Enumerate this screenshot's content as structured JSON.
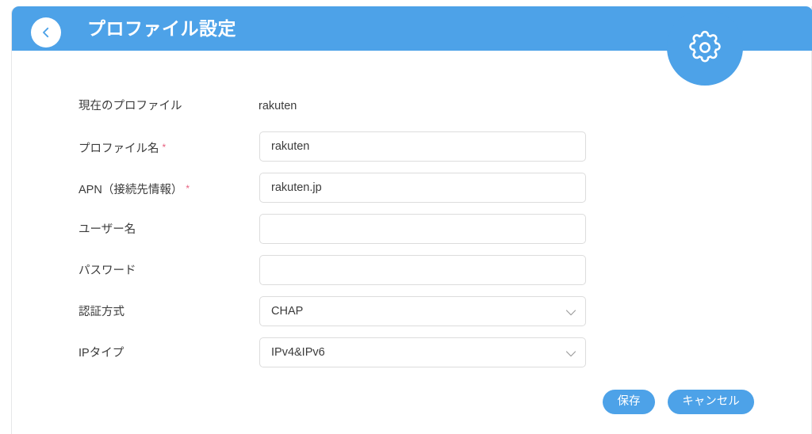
{
  "header": {
    "title": "プロファイル設定",
    "back_icon": "chevron-left-icon",
    "gear_icon": "gear-icon",
    "background_color": "#4da2e8"
  },
  "form": {
    "rows": [
      {
        "label": "現在のプロファイル",
        "required": "",
        "type": "static",
        "value": "rakuten"
      },
      {
        "label": "プロファイル名",
        "required": "*",
        "type": "text",
        "value": "rakuten",
        "placeholder": ""
      },
      {
        "label": "APN（接続先情報）",
        "required": "*",
        "type": "text",
        "value": "rakuten.jp",
        "placeholder": ""
      },
      {
        "label": "ユーザー名",
        "required": "",
        "type": "text",
        "value": "",
        "placeholder": ""
      },
      {
        "label": "パスワード",
        "required": "",
        "type": "password",
        "value": "",
        "placeholder": ""
      },
      {
        "label": "認証方式",
        "required": "",
        "type": "select",
        "value": "CHAP",
        "chevron_icon": "chevron-down-icon"
      },
      {
        "label": "IPタイプ",
        "required": "",
        "type": "select",
        "value": "IPv4&IPv6",
        "chevron_icon": "chevron-down-icon"
      }
    ]
  },
  "footer": {
    "save_label": "保存",
    "cancel_label": "キャンセル",
    "button_color": "#4da2e8"
  },
  "colors": {
    "accent": "#4da2e8",
    "required_marker": "#e8607f",
    "text": "#3b3b3b",
    "field_border": "#dcdcdc"
  }
}
